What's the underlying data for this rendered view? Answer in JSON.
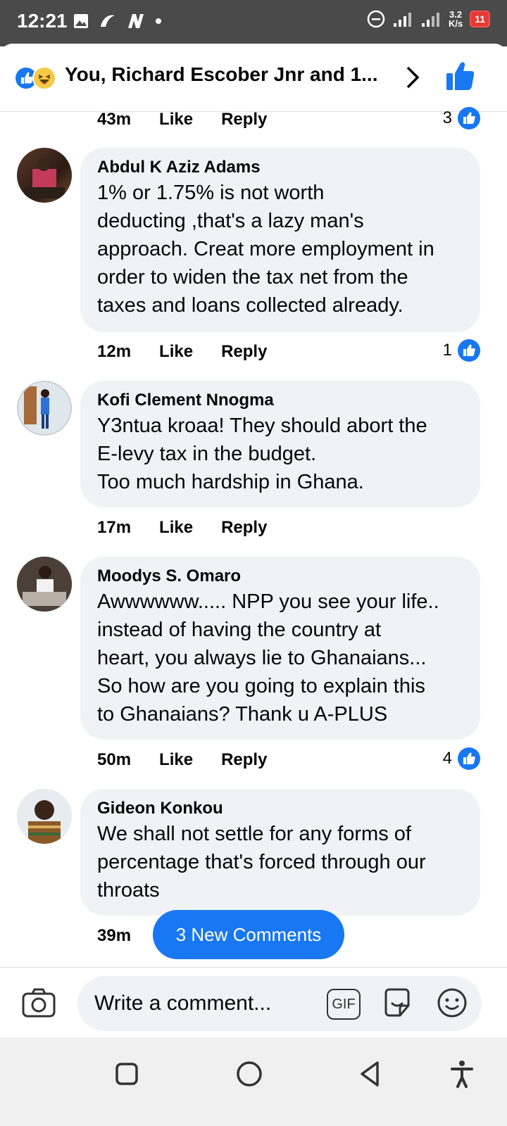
{
  "status_bar": {
    "time": "12:21",
    "network_speed_value": "3.2",
    "network_speed_unit": "K/s",
    "battery": "11"
  },
  "header": {
    "title": "You, Richard Escober Jnr and 1..."
  },
  "top_meta": {
    "time": "43m",
    "like": "Like",
    "reply": "Reply",
    "count": "3"
  },
  "comments": [
    {
      "author": "Abdul K Aziz Adams",
      "text": "1% or 1.75% is not worth\ndeducting ,that's a lazy man's\napproach. Creat more employment in\norder to widen the tax net from the\ntaxes and loans collected already.",
      "time": "12m",
      "like": "Like",
      "reply": "Reply",
      "count": "1"
    },
    {
      "author": "Kofi Clement Nnogma",
      "text": "Y3ntua kroaa! They should abort the\nE-levy  tax in the budget.\nToo much hardship in Ghana.",
      "time": "17m",
      "like": "Like",
      "reply": "Reply",
      "count": ""
    },
    {
      "author": "Moodys S. Omaro",
      "text": "Awwwwww..... NPP you see your life..\ninstead of having the country at\nheart, you always lie to Ghanaians...\nSo how are you going to explain this\nto Ghanaians?  Thank u A-PLUS",
      "time": "50m",
      "like": "Like",
      "reply": "Reply",
      "count": "4"
    },
    {
      "author": "Gideon Konkou",
      "text": "We shall not settle for any forms of\npercentage that's forced through our\nthroats",
      "time": "39m",
      "like": "",
      "reply": "",
      "count": ""
    }
  ],
  "new_comments_button": "3 New Comments",
  "composer": {
    "placeholder": "Write a comment...",
    "gif_label": "GIF"
  },
  "colors": {
    "accent": "#1877f2",
    "bubble": "#f0f2f5",
    "status_bar": "#4a4a4a"
  }
}
